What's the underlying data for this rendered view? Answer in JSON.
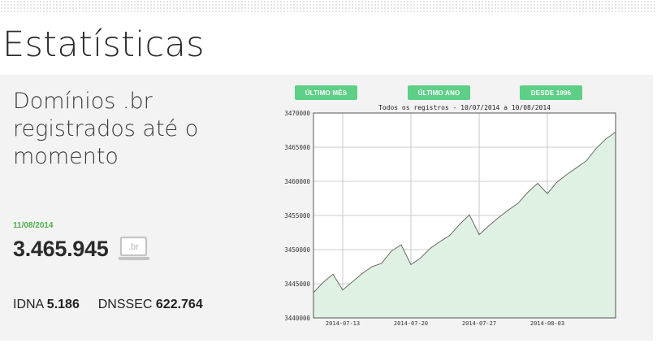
{
  "page": {
    "title": "Estatísticas"
  },
  "summary": {
    "headline": "Domínios .br registrados até o momento",
    "date": "11/08/2014",
    "count": "3.465.945",
    "badge": ".br",
    "idna_label": "IDNA",
    "idna_value": "5.186",
    "dnssec_label": "DNSSEC",
    "dnssec_value": "622.764"
  },
  "range_buttons": {
    "last_month": "ÚLTIMO MÊS",
    "last_year": "ÚLTIMO ANO",
    "since_1996": "DESDE 1996"
  },
  "colors": {
    "accent_green": "#5ecf86",
    "date_green": "#4caf50",
    "area_fill": "#dff1e2",
    "area_line": "#6b6b6b",
    "panel_bg": "#f4f3f3"
  },
  "icons": {
    "laptop": "laptop-icon"
  },
  "chart_data": {
    "type": "area",
    "title": "Todos os registros - 10/07/2014 a 10/08/2014",
    "xlabel": "",
    "ylabel": "",
    "grid": true,
    "ylim": [
      3440000,
      3470000
    ],
    "y_ticks": [
      "3440000",
      "3445000",
      "3450000",
      "3455000",
      "3460000",
      "3465000",
      "3470000"
    ],
    "x_ticks": [
      "2014-07-13",
      "2014-07-20",
      "2014-07-27",
      "2014-08-03"
    ],
    "x_range": [
      "2014-07-10",
      "2014-08-10"
    ],
    "series": [
      {
        "x": [
          "2014-07-10",
          "2014-07-11",
          "2014-07-12",
          "2014-07-13",
          "2014-07-14",
          "2014-07-15",
          "2014-07-16",
          "2014-07-17",
          "2014-07-18",
          "2014-07-19",
          "2014-07-20",
          "2014-07-21",
          "2014-07-22",
          "2014-07-23",
          "2014-07-24",
          "2014-07-25",
          "2014-07-26",
          "2014-07-27",
          "2014-07-28",
          "2014-07-29",
          "2014-07-30",
          "2014-07-31",
          "2014-08-01",
          "2014-08-02",
          "2014-08-03",
          "2014-08-04",
          "2014-08-05",
          "2014-08-06",
          "2014-08-07",
          "2014-08-08",
          "2014-08-09",
          "2014-08-10"
        ],
        "values": [
          3443700,
          3445200,
          3446400,
          3444100,
          3445300,
          3446500,
          3447500,
          3448000,
          3449800,
          3450700,
          3447800,
          3448800,
          3450200,
          3451200,
          3452100,
          3453700,
          3455100,
          3452200,
          3453500,
          3454700,
          3455800,
          3456800,
          3458400,
          3459700,
          3458200,
          3459900,
          3461000,
          3462000,
          3463000,
          3464800,
          3466200,
          3467200
        ]
      }
    ]
  }
}
